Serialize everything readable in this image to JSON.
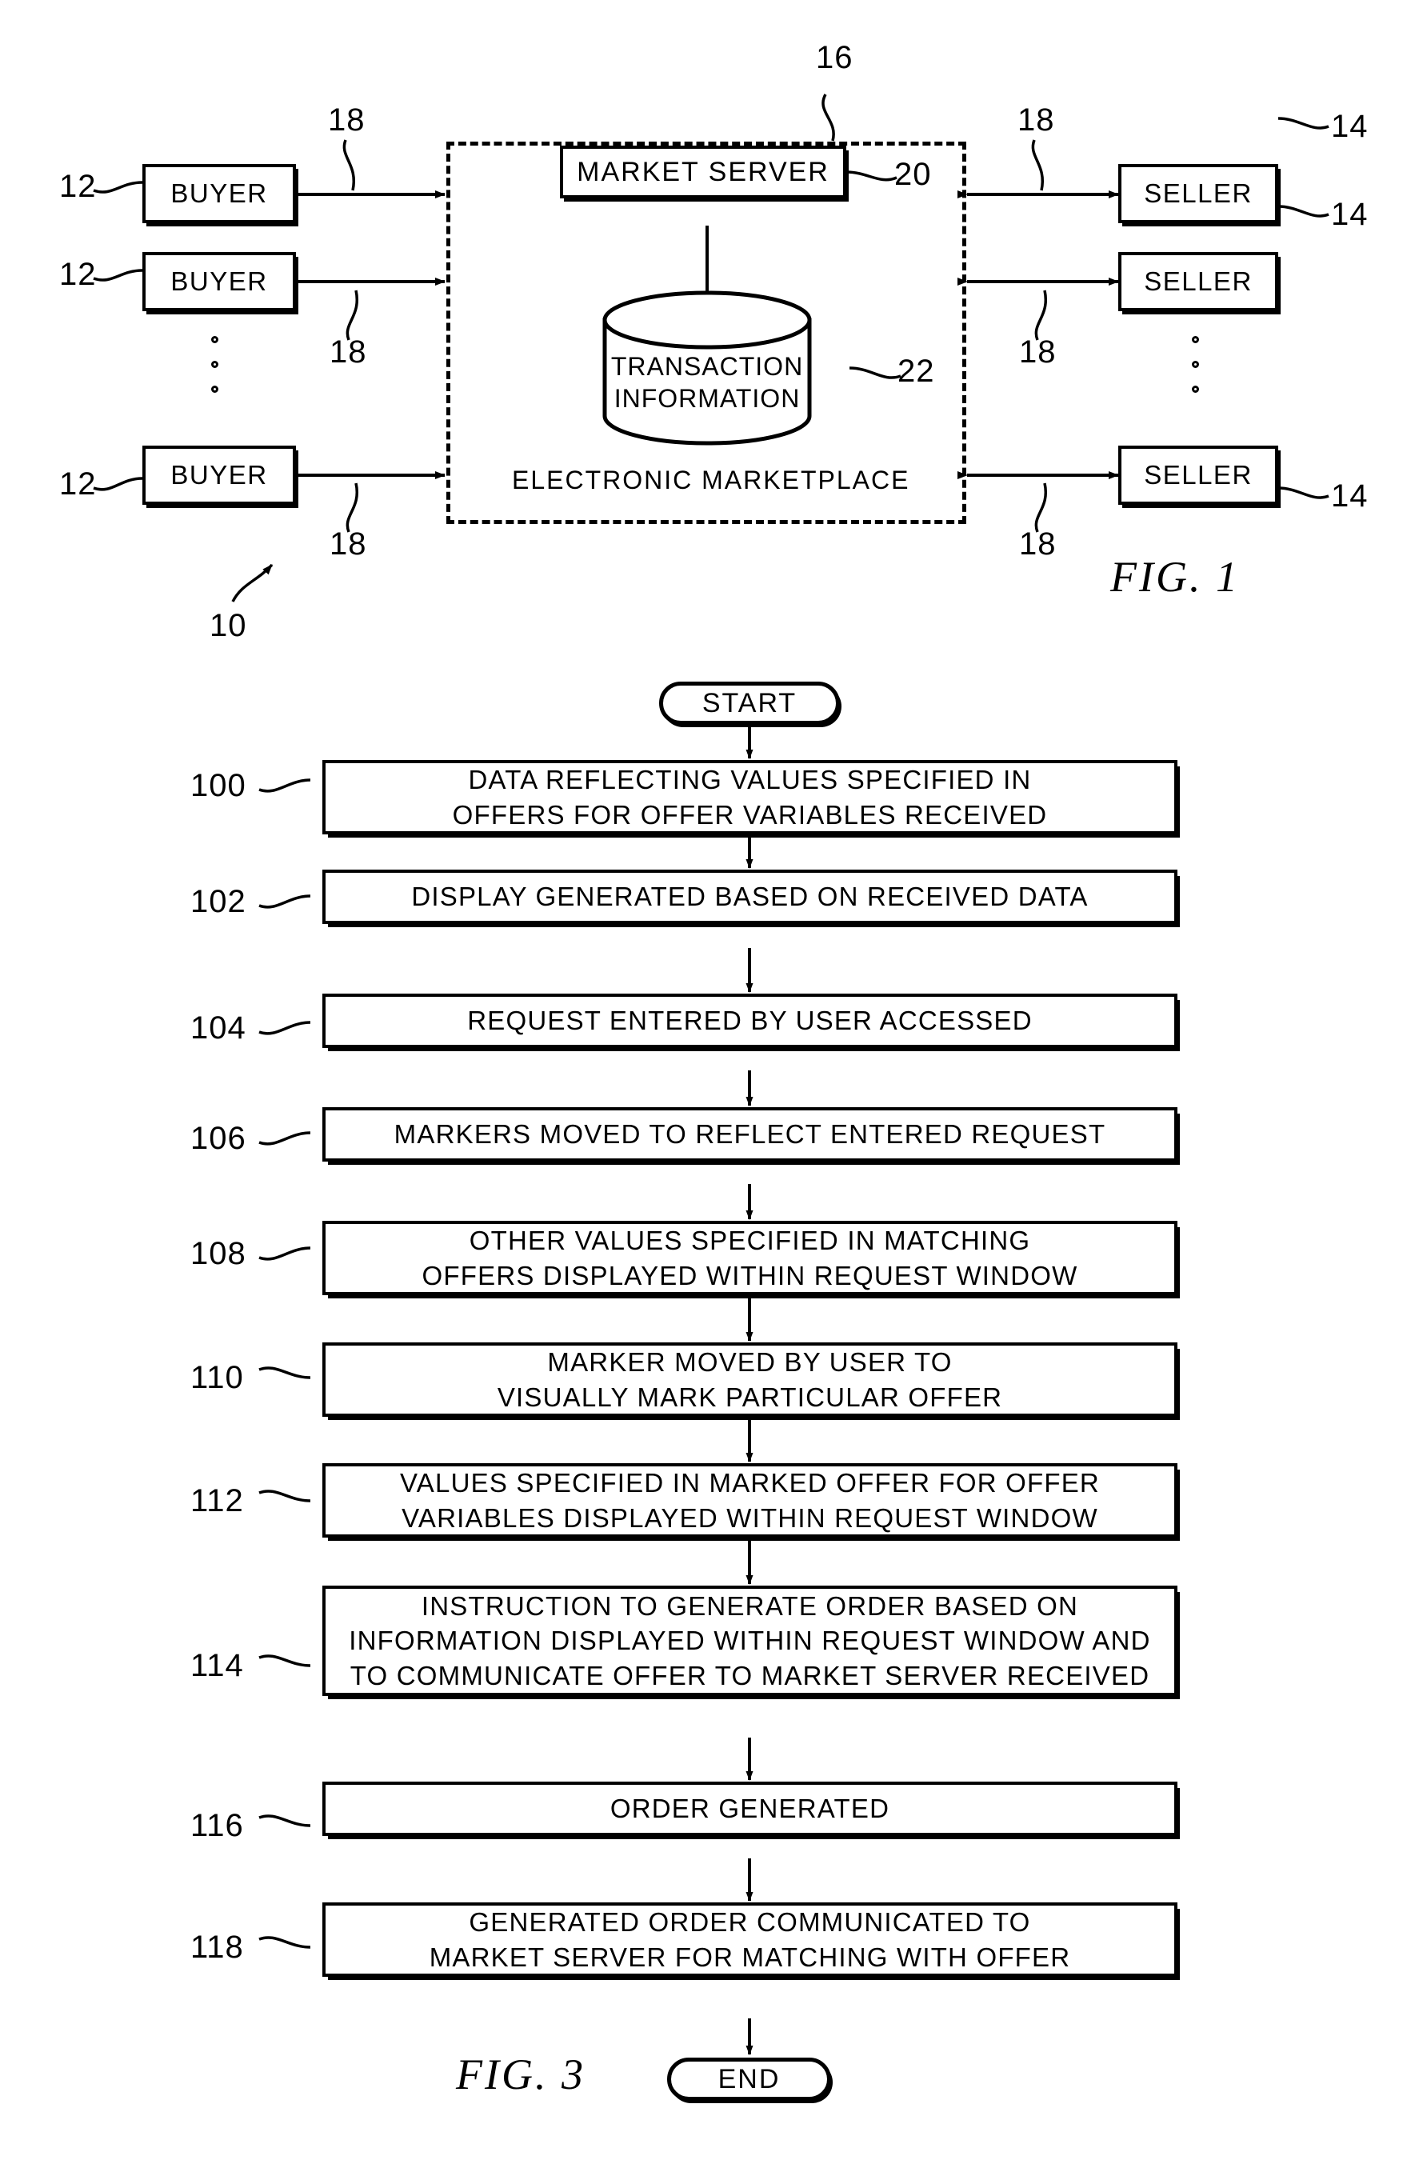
{
  "figure1": {
    "title": "FIG.  1",
    "system_ref": "10",
    "buyers": [
      {
        "label": "BUYER",
        "ref": "12"
      },
      {
        "label": "BUYER",
        "ref": "12"
      },
      {
        "label": "BUYER",
        "ref": "12"
      }
    ],
    "sellers": [
      {
        "label": "SELLER",
        "ref": "14"
      },
      {
        "label": "SELLER",
        "ref": "14"
      },
      {
        "label": "SELLER",
        "ref": "14"
      }
    ],
    "marketplace": {
      "label": "ELECTRONIC MARKETPLACE",
      "ref": "16"
    },
    "server": {
      "label": "MARKET SERVER",
      "ref": "20"
    },
    "database": {
      "line1": "TRANSACTION",
      "line2": "INFORMATION",
      "ref": "22"
    },
    "link_refs": [
      "18",
      "18",
      "18",
      "18",
      "18",
      "18"
    ]
  },
  "figure3": {
    "title": "FIG.  3",
    "start_label": "START",
    "end_label": "END",
    "steps": [
      {
        "ref": "100",
        "text": "DATA REFLECTING VALUES SPECIFIED IN\nOFFERS FOR OFFER VARIABLES RECEIVED"
      },
      {
        "ref": "102",
        "text": "DISPLAY GENERATED BASED ON RECEIVED DATA"
      },
      {
        "ref": "104",
        "text": "REQUEST ENTERED BY USER ACCESSED"
      },
      {
        "ref": "106",
        "text": "MARKERS MOVED TO REFLECT ENTERED REQUEST"
      },
      {
        "ref": "108",
        "text": "OTHER VALUES SPECIFIED IN MATCHING\nOFFERS DISPLAYED WITHIN REQUEST WINDOW"
      },
      {
        "ref": "110",
        "text": "MARKER MOVED BY USER TO\nVISUALLY MARK PARTICULAR OFFER"
      },
      {
        "ref": "112",
        "text": "VALUES SPECIFIED IN MARKED OFFER FOR OFFER\nVARIABLES DISPLAYED WITHIN REQUEST WINDOW"
      },
      {
        "ref": "114",
        "text": "INSTRUCTION TO GENERATE ORDER BASED ON\nINFORMATION DISPLAYED WITHIN REQUEST WINDOW AND\nTO COMMUNICATE OFFER TO MARKET SERVER RECEIVED"
      },
      {
        "ref": "116",
        "text": "ORDER GENERATED"
      },
      {
        "ref": "118",
        "text": "GENERATED ORDER COMMUNICATED TO\nMARKET SERVER FOR MATCHING WITH OFFER"
      }
    ]
  },
  "colors": {
    "ink": "#000000",
    "paper": "#ffffff"
  }
}
